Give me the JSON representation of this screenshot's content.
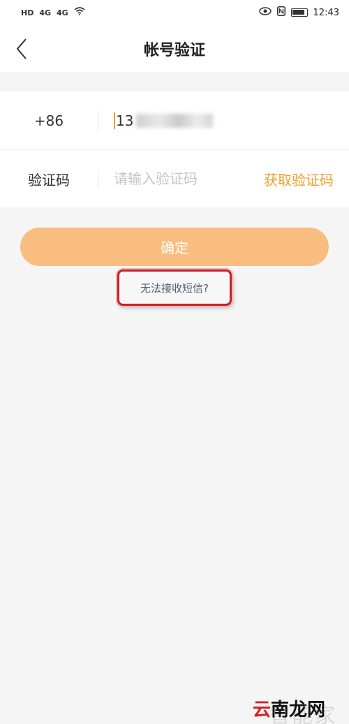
{
  "status_bar": {
    "left_icons": [
      "HD",
      "4G",
      "4G"
    ],
    "time": "12:43"
  },
  "nav": {
    "title": "帐号验证"
  },
  "form": {
    "phone": {
      "country_code": "+86",
      "number_visible": "13"
    },
    "code": {
      "label": "验证码",
      "placeholder": "请输入验证码",
      "get_code_label": "获取验证码"
    }
  },
  "confirm_label": "确定",
  "no_sms_label": "无法接收短信?",
  "watermark": {
    "site": "智能家",
    "brand_prefix": "云",
    "brand_rest": "南龙网"
  },
  "colors": {
    "accent": "#f0a030",
    "confirm_bg": "#f9bd7f",
    "highlight_border": "#c8202a"
  }
}
